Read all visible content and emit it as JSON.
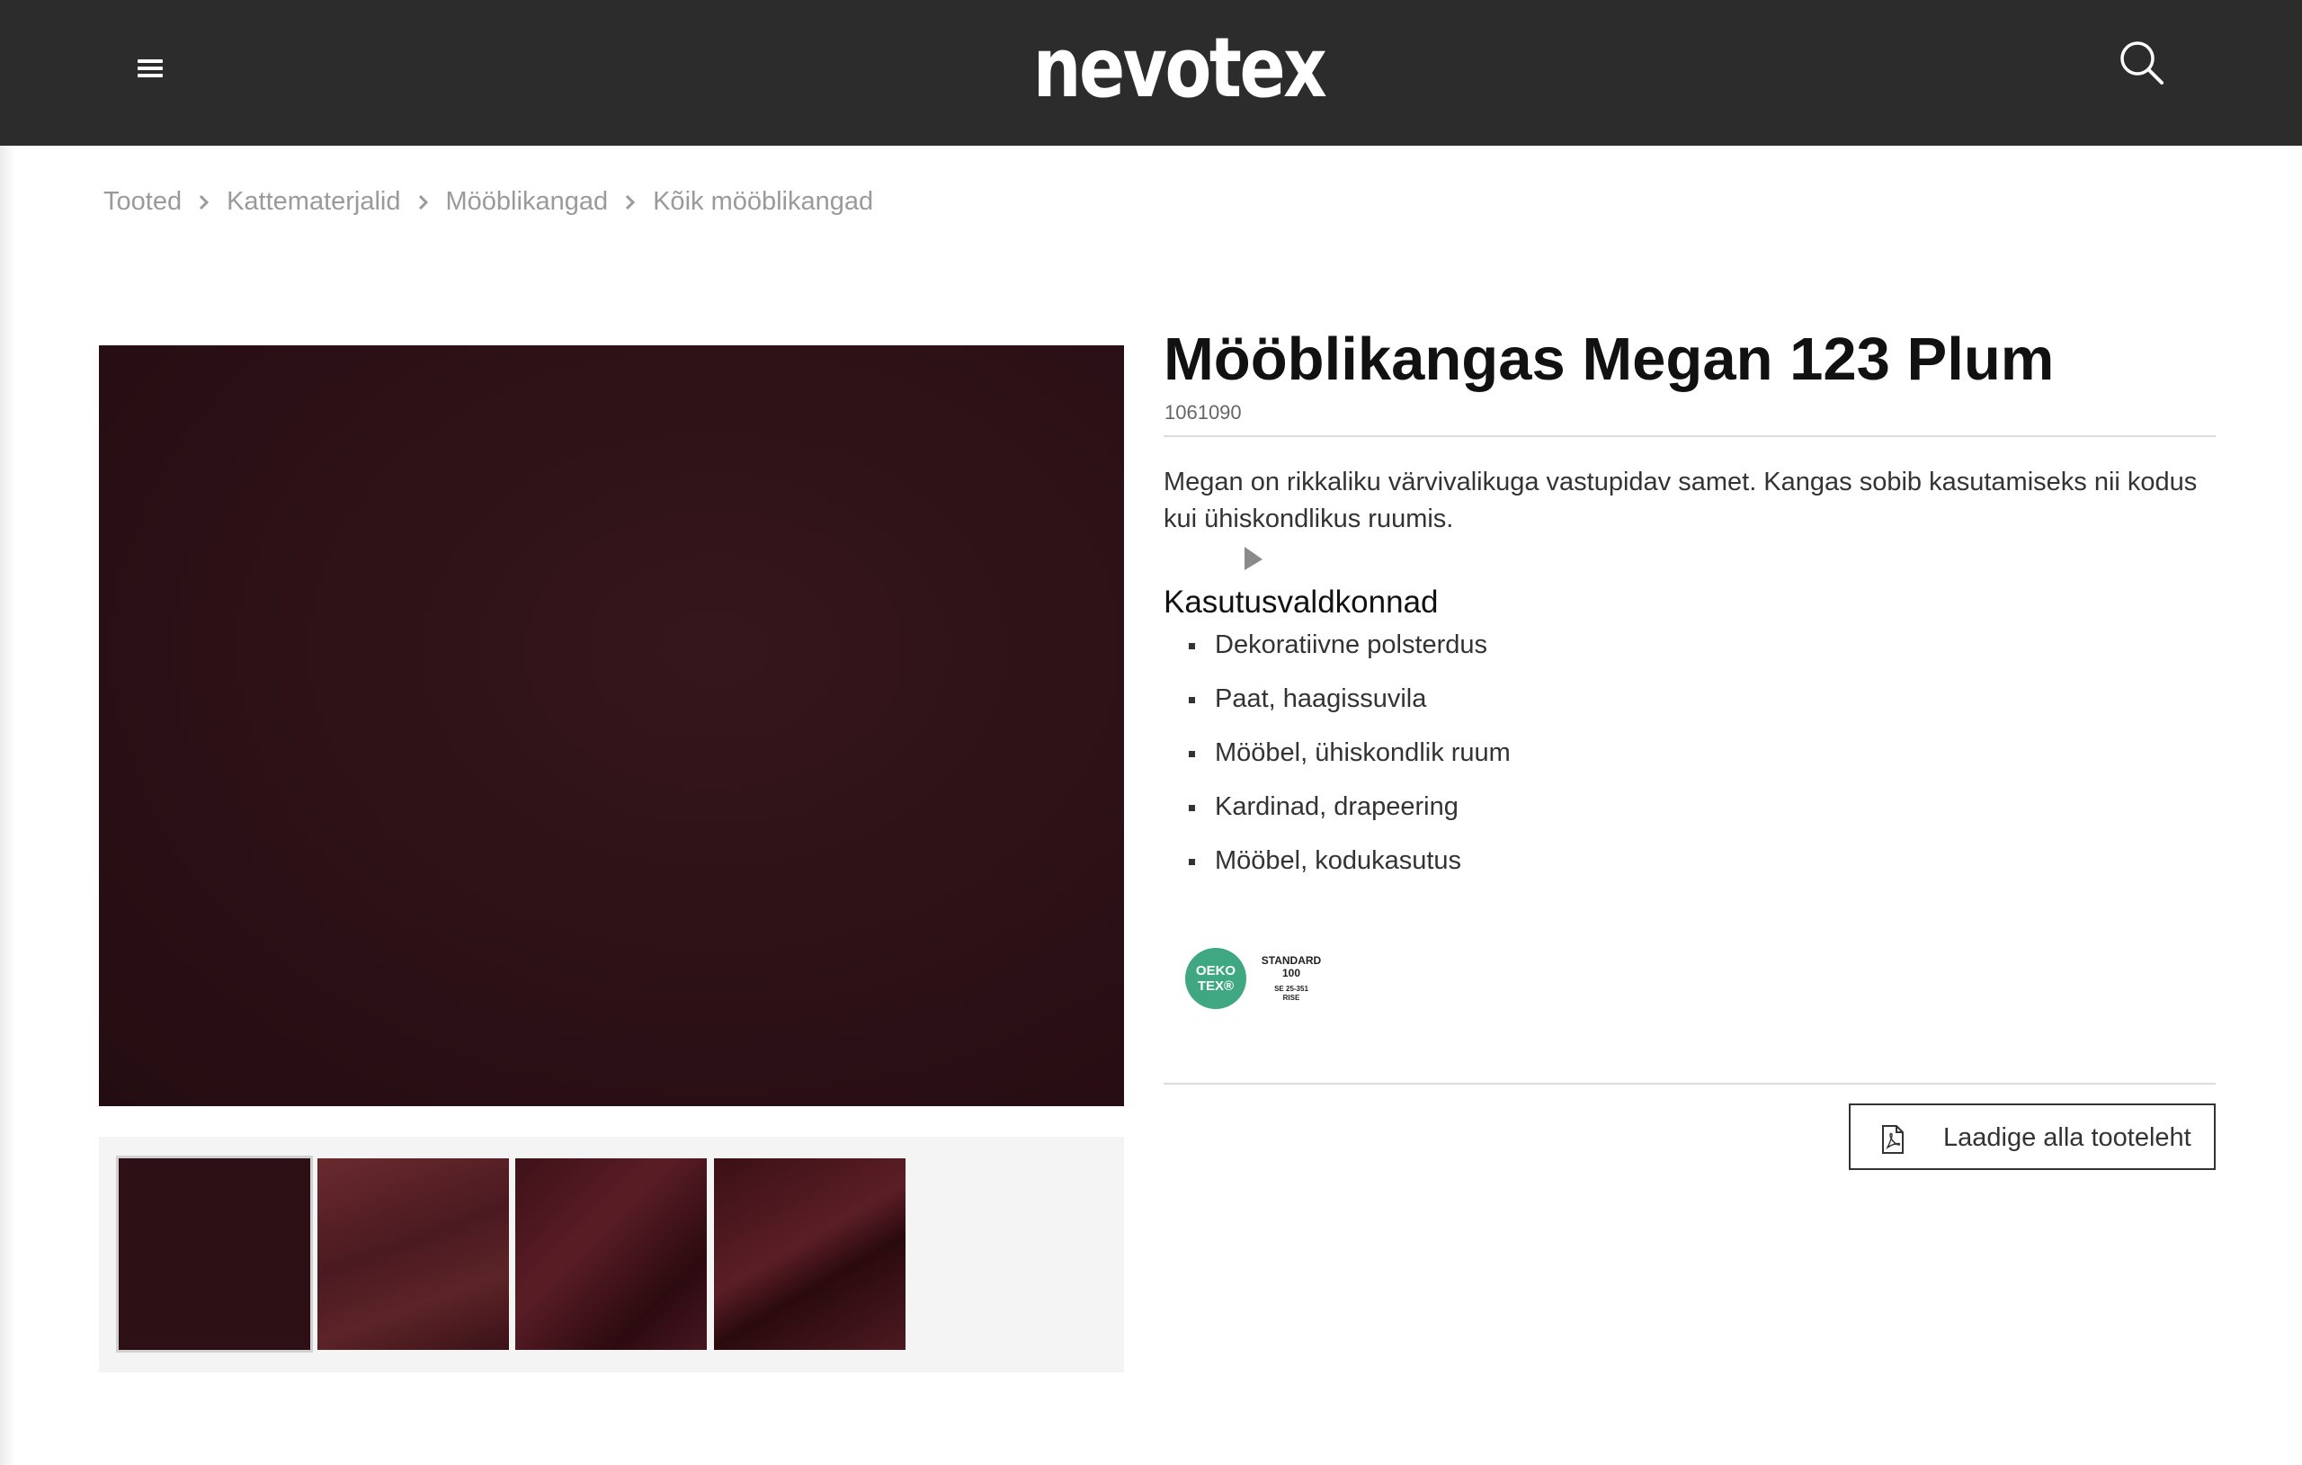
{
  "header": {
    "logo_text": "nevotex",
    "menu_icon": "hamburger-menu-icon",
    "search_icon": "search-icon",
    "background_color": "#2c2c2c"
  },
  "breadcrumb": {
    "items": [
      "Tooted",
      "Kattematerjalid",
      "Mööblikangad",
      "Kõik mööblikangad"
    ],
    "separator_icon": "chevron-right-icon"
  },
  "gallery": {
    "thumbnail_count": 4,
    "active_thumbnail": 1,
    "fabric_color": "#2b1016"
  },
  "product": {
    "title": "Mööblikangas Megan 123 Plum",
    "sku": "1061090",
    "description": "Megan on rikkaliku värvivalikuga vastupidav samet. Kangas sobib kasutamiseks nii kodus kui ühiskondlikus ruumis.",
    "usage_heading": "Kasutusvaldkonnad",
    "usage_items": [
      "Dekoratiivne polsterdus",
      "Paat, haagissuvila",
      "Mööbel, ühiskondlik ruum",
      "Kardinad, drapeering",
      "Mööbel, kodukasutus"
    ]
  },
  "certification": {
    "circle_line1": "OEKO",
    "circle_line2": "TEX®",
    "standard_line1": "STANDARD",
    "standard_line2": "100",
    "standard_line3": "SE 25-351",
    "standard_line4": "RISE",
    "brand_color": "#3fa883"
  },
  "download": {
    "label": "Laadige alla tooteleht",
    "icon": "pdf-file-icon"
  }
}
